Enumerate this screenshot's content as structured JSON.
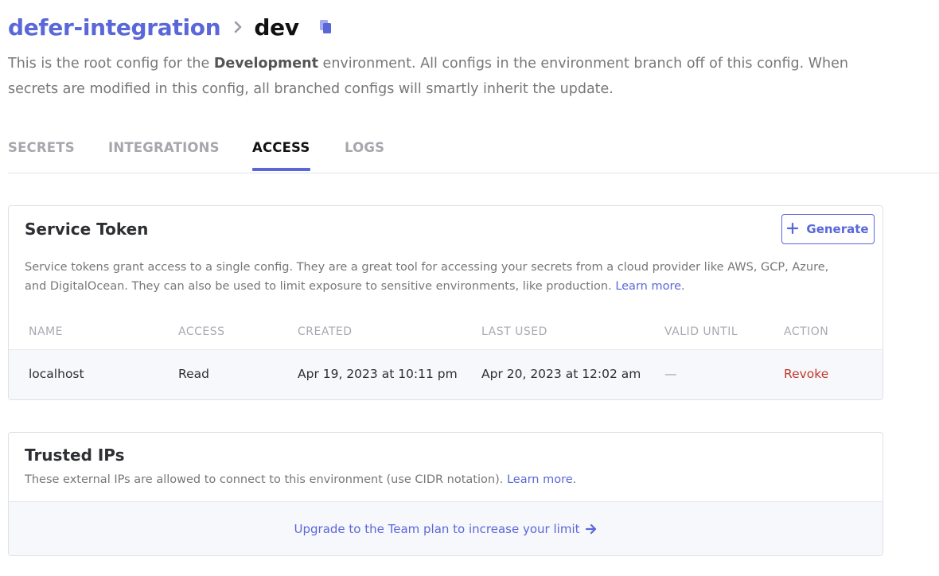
{
  "breadcrumb": {
    "project": "defer-integration",
    "config": "dev"
  },
  "description": {
    "before": "This is the root config for the ",
    "environment": "Development",
    "after": " environment. All configs in the environment branch off of this config. When secrets are modified in this config, all branched configs will smartly inherit the update."
  },
  "tabs": [
    {
      "label": "SECRETS",
      "active": false
    },
    {
      "label": "INTEGRATIONS",
      "active": false
    },
    {
      "label": "ACCESS",
      "active": true
    },
    {
      "label": "LOGS",
      "active": false
    }
  ],
  "service_token": {
    "title": "Service Token",
    "generate_label": "Generate",
    "description": "Service tokens grant access to a single config. They are a great tool for accessing your secrets from a cloud provider like AWS, GCP, Azure, and DigitalOcean. They can also be used to limit exposure to sensitive environments, like production.",
    "learn_more": "Learn more",
    "columns": [
      "NAME",
      "ACCESS",
      "CREATED",
      "LAST USED",
      "VALID UNTIL",
      "ACTION"
    ],
    "rows": [
      {
        "name": "localhost",
        "access": "Read",
        "created": "Apr 19, 2023 at 10:11 pm",
        "last_used": "Apr 20, 2023 at 12:02 am",
        "valid_until": "—",
        "action": "Revoke"
      }
    ]
  },
  "trusted_ips": {
    "title": "Trusted IPs",
    "description": "These external IPs are allowed to connect to this environment (use CIDR notation).",
    "learn_more": "Learn more",
    "upgrade_label": "Upgrade to the Team plan to increase your limit"
  },
  "colors": {
    "accent": "#5a67d8",
    "danger": "#c0392b",
    "muted": "#a5a7ad"
  },
  "icons": {
    "breadcrumb_separator": "chevron-right-icon",
    "copy": "copy-icon",
    "generate": "plus-icon",
    "upgrade": "arrow-right-icon"
  }
}
